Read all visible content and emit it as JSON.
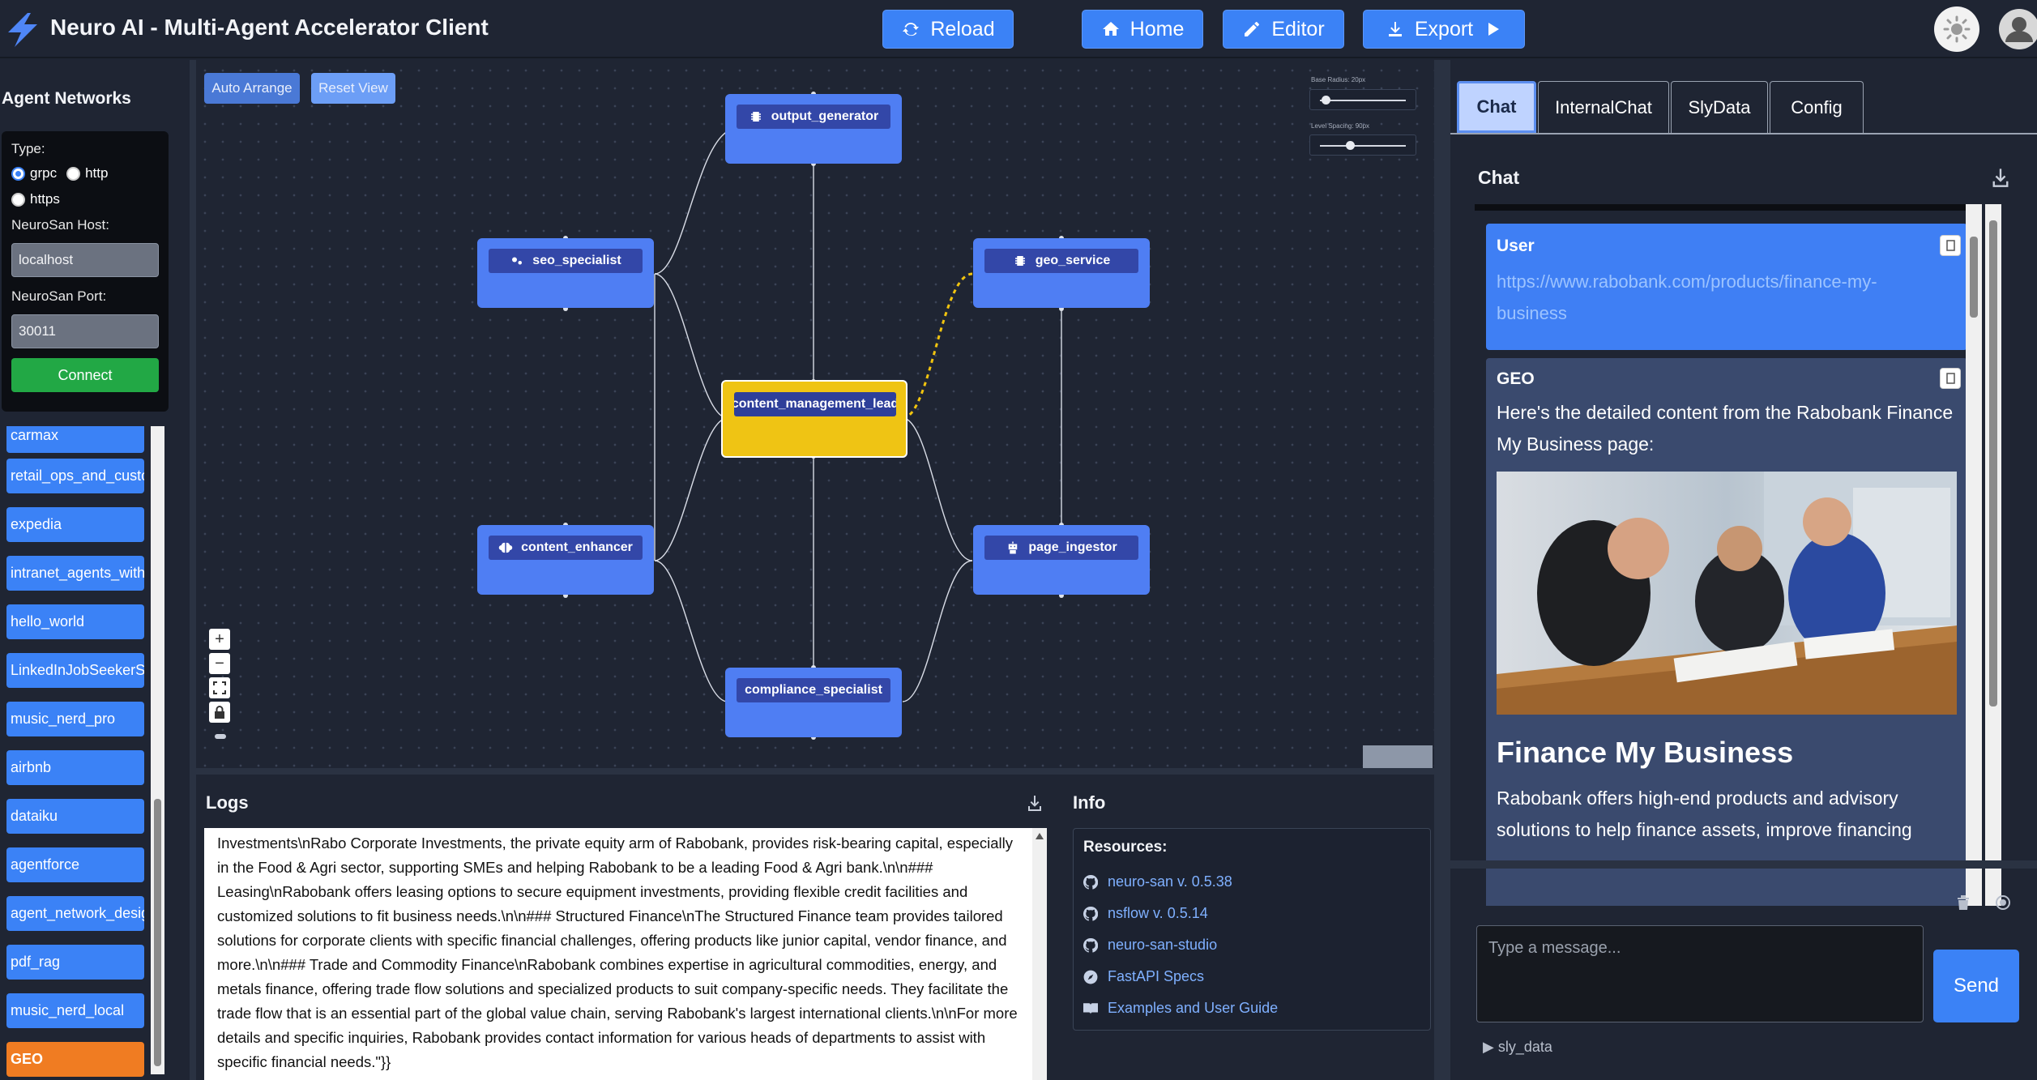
{
  "header": {
    "title": "Neuro AI - Multi-Agent Accelerator Client",
    "buttons": {
      "reload": "Reload",
      "home": "Home",
      "editor": "Editor",
      "export": "Export"
    }
  },
  "sidebar": {
    "title": "Agent Networks",
    "connection": {
      "type_label": "Type:",
      "types": [
        "grpc",
        "http",
        "https"
      ],
      "selected_type": "grpc",
      "host_label": "NeuroSan Host:",
      "host_value": "localhost",
      "port_label": "NeuroSan Port:",
      "port_value": "30011",
      "connect_label": "Connect"
    },
    "networks": [
      "carmax",
      "retail_ops_and_customer",
      "expedia",
      "intranet_agents_with_tools",
      "hello_world",
      "LinkedInJobSeekerSupport",
      "music_nerd_pro",
      "airbnb",
      "dataiku",
      "agentforce",
      "agent_network_designer",
      "pdf_rag",
      "music_nerd_local",
      "GEO"
    ],
    "active_network": "GEO"
  },
  "graph": {
    "auto_arrange": "Auto Arrange",
    "reset_view": "Reset View",
    "base_radius_label": "Base Radius: 20px",
    "base_radius_value": 20,
    "level_spacing_label": "Level Spacing: 90px",
    "level_spacing_value": 90,
    "nodes": {
      "output_generator": "output_generator",
      "seo_specialist": "seo_specialist",
      "geo_service": "geo_service",
      "content_management_lead": "content_management_lead",
      "content_enhancer": "content_enhancer",
      "page_ingestor": "page_ingestor",
      "compliance_specialist": "compliance_specialist"
    },
    "zoom_in": "+",
    "zoom_out": "−"
  },
  "logs": {
    "title": "Logs",
    "text": "Investments\\nRabo Corporate Investments, the private equity arm of Rabobank, provides risk-bearing capital, especially in the Food & Agri sector, supporting SMEs and helping Rabobank to be a leading Food & Agri bank.\\n\\n### Leasing\\nRabobank offers leasing options to secure equipment investments, providing flexible credit facilities and customized solutions to fit business needs.\\n\\n### Structured Finance\\nThe Structured Finance team provides tailored solutions for corporate clients with specific financial challenges, offering products like junior capital, vendor finance, and more.\\n\\n### Trade and Commodity Finance\\nRabobank combines expertise in agricultural commodities, energy, and metals finance, offering trade flow solutions and specialized products to suit company-specific needs. They facilitate the trade flow that is an essential part of the global value chain, serving Rabobank's largest international clients.\\n\\nFor more details and specific inquiries, Rabobank provides contact information for various heads of departments to assist with specific financial needs.\"}}"
  },
  "info": {
    "title": "Info",
    "resources_label": "Resources:",
    "links": [
      "neuro-san v. 0.5.38",
      "nsflow v. 0.5.14",
      "neuro-san-studio",
      "FastAPI Specs",
      "Examples and User Guide"
    ]
  },
  "right_panel": {
    "tabs": [
      "Chat",
      "InternalChat",
      "SlyData",
      "Config"
    ],
    "active_tab": "Chat",
    "chat_title": "Chat",
    "messages": {
      "user_role": "User",
      "user_text": "https://www.rabobank.com/products/finance-my-business",
      "geo_role": "GEO",
      "geo_intro": "Here's the detailed content from the Rabobank Finance My Business page:",
      "geo_heading": "Finance My Business",
      "geo_body": "Rabobank offers high-end products and advisory solutions to help finance assets, improve financing"
    },
    "input_placeholder": "Type a message...",
    "send_label": "Send",
    "sly_data_toggle": "▶ sly_data"
  },
  "colors": {
    "accent": "#3b82f6",
    "lead_node": "#efc414",
    "node": "#4f7ef3",
    "active_network": "#f07c22",
    "connect": "#22a845"
  }
}
